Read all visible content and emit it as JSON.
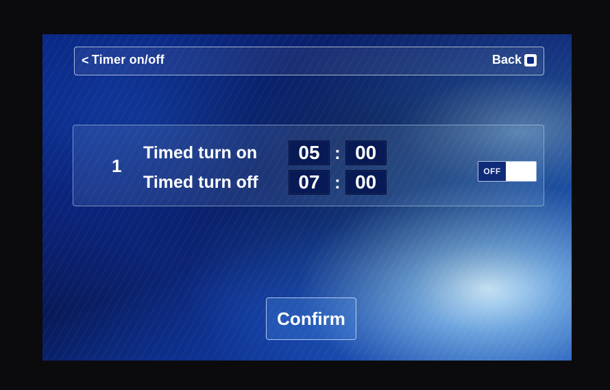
{
  "header": {
    "title": "Timer on/off",
    "back_label": "Back",
    "back_icon": "back-icon"
  },
  "timer": {
    "index": "1",
    "on_label": "Timed turn on",
    "on_hour": "05",
    "on_minute": "00",
    "off_label": "Timed turn off",
    "off_hour": "07",
    "off_minute": "00",
    "colon": ":",
    "toggle_state_label": "OFF"
  },
  "actions": {
    "confirm_label": "Confirm"
  }
}
